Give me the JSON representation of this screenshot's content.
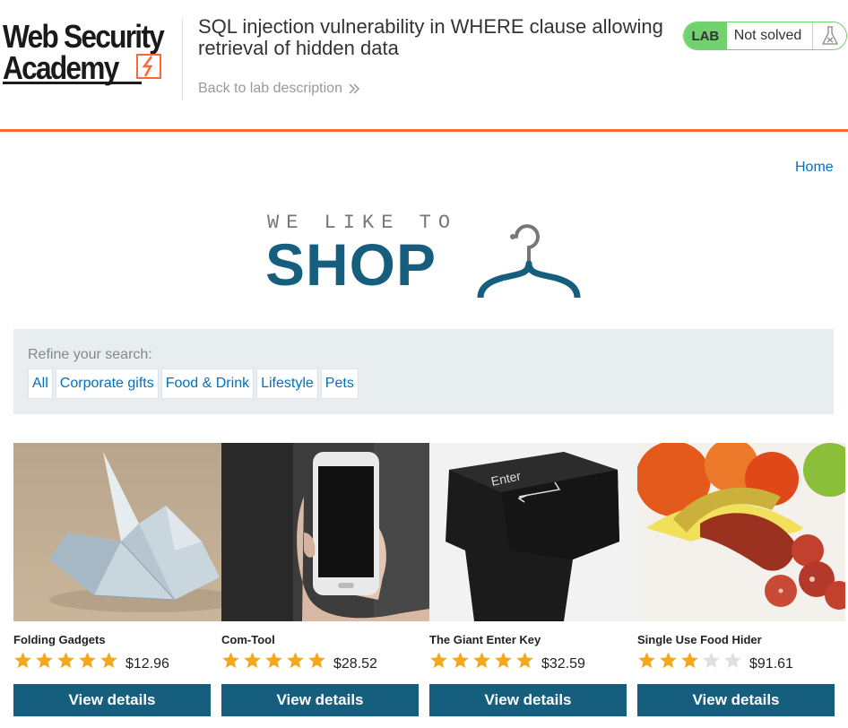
{
  "header": {
    "logo_line1": "Web Security",
    "logo_line2": "Academy",
    "lab_title": "SQL injection vulnerability in WHERE clause allowing retrieval of hidden data",
    "back_link": "Back to lab description",
    "status_badge": "LAB",
    "status_text": "Not solved"
  },
  "nav": {
    "home": "Home"
  },
  "banner": {
    "tagline": "WE LIKE TO",
    "word": "SHOP"
  },
  "filter": {
    "label": "Refine your search:",
    "categories": [
      "All",
      "Corporate gifts",
      "Food & Drink",
      "Lifestyle",
      "Pets"
    ]
  },
  "products": [
    {
      "name": "Folding Gadgets",
      "price": "$12.96",
      "rating": 5,
      "button": "View details"
    },
    {
      "name": "Com-Tool",
      "price": "$28.52",
      "rating": 5,
      "button": "View details"
    },
    {
      "name": "The Giant Enter Key",
      "price": "$32.59",
      "rating": 5,
      "button": "View details"
    },
    {
      "name": "Single Use Food Hider",
      "price": "$91.61",
      "rating": 3,
      "button": "View details"
    }
  ],
  "colors": {
    "accent": "#ff6633",
    "brand": "#155e7d",
    "link": "#0071bc",
    "solved_green": "#70d16d",
    "star": "#f7a71b"
  }
}
